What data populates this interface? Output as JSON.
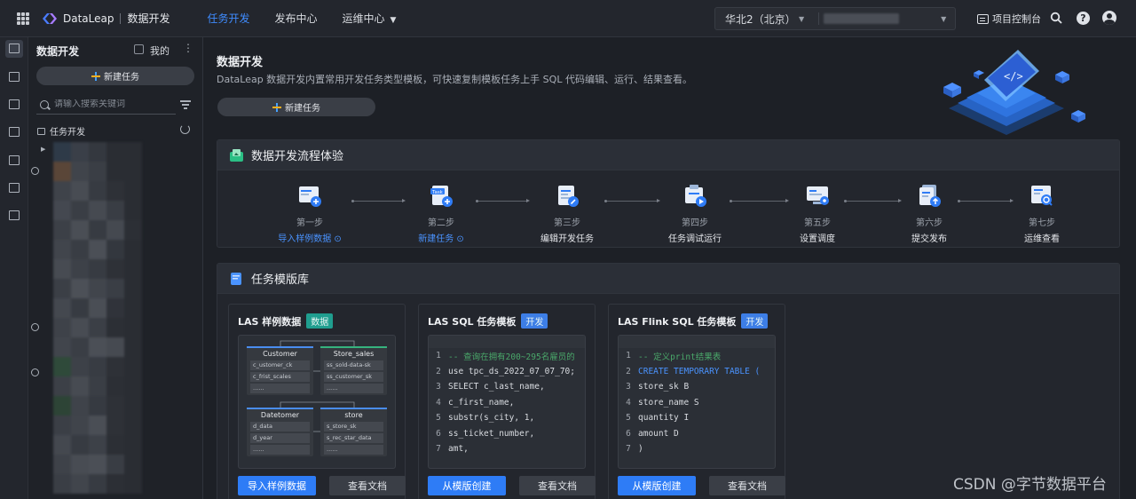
{
  "topbar": {
    "brand": "DataLeap",
    "product": "数据开发",
    "nav": [
      {
        "label": "任务开发",
        "active": true
      },
      {
        "label": "发布中心",
        "active": false
      },
      {
        "label": "运维中心",
        "active": false
      }
    ],
    "region": "华北2（北京）",
    "console_label": "项目控制台",
    "help_label": "?"
  },
  "sidebar": {
    "title": "数据开发",
    "mine_label": "我的",
    "more_label": "⋮",
    "new_task_label": "新建任务",
    "search_placeholder": "请输入搜索关键词",
    "tree_root_label": "任务开发"
  },
  "main": {
    "title": "数据开发",
    "description": "DataLeap 数据开发内置常用开发任务类型模板，可快速复制模板任务上手 SQL 代码编辑、运行、结果查看。",
    "new_task_label": "新建任务",
    "flow": {
      "title": "数据开发流程体验",
      "steps": [
        {
          "num": "第一步",
          "name": "导入样例数据 ⊙",
          "link": true
        },
        {
          "num": "第二步",
          "name": "新建任务 ⊙",
          "link": true
        },
        {
          "num": "第三步",
          "name": "编辑开发任务",
          "link": false
        },
        {
          "num": "第四步",
          "name": "任务调试运行",
          "link": false
        },
        {
          "num": "第五步",
          "name": "设置调度",
          "link": false
        },
        {
          "num": "第六步",
          "name": "提交发布",
          "link": false
        },
        {
          "num": "第七步",
          "name": "运维查看",
          "link": false
        }
      ]
    },
    "library": {
      "title": "任务模版库",
      "templates": [
        {
          "title": "LAS 样例数据",
          "tag": "数据",
          "primary": "导入样例数据",
          "secondary": "查看文档",
          "er": {
            "tables": [
              {
                "name": "Customer",
                "rows": [
                  "c_ustomer_ck",
                  "c_frist_scales",
                  "......"
                ]
              },
              {
                "name": "Store_sales",
                "rows": [
                  "ss_sold-data-sk",
                  "ss_customer_sk",
                  "......"
                ]
              },
              {
                "name": "Datetomer",
                "rows": [
                  "d_data",
                  "d_year",
                  "......"
                ]
              },
              {
                "name": "store",
                "rows": [
                  "s_store_sk",
                  "s_rec_star_data",
                  "......"
                ]
              }
            ]
          }
        },
        {
          "title": "LAS SQL 任务模板",
          "tag": "开发",
          "primary": "从模版创建",
          "secondary": "查看文档",
          "code": [
            {
              "n": "1",
              "text": "-- 查询在拥有200~295名雇员的"
            },
            {
              "n": "2",
              "text": "use tpc_ds_2022_07_07_70;"
            },
            {
              "n": "3",
              "text": "SELECT  c_last_name,"
            },
            {
              "n": "4",
              "text": "        c_first_name,"
            },
            {
              "n": "5",
              "text": "        substr(s_city, 1,"
            },
            {
              "n": "6",
              "text": "        ss_ticket_number,"
            },
            {
              "n": "7",
              "text": "        amt,"
            }
          ]
        },
        {
          "title": "LAS Flink SQL 任务模板",
          "tag": "开发",
          "primary": "从模版创建",
          "secondary": "查看文档",
          "code": [
            {
              "n": "1",
              "text": "-- 定义print结果表"
            },
            {
              "n": "2",
              "text": "CREATE  TEMPORARY TABLE ("
            },
            {
              "n": "3",
              "text": "           store_sk    B"
            },
            {
              "n": "4",
              "text": "           store_name S"
            },
            {
              "n": "5",
              "text": "           quantity    I"
            },
            {
              "n": "6",
              "text": "           amount      D"
            },
            {
              "n": "7",
              "text": "        )"
            }
          ]
        }
      ]
    }
  },
  "watermark": "CSDN @字节数据平台",
  "colors": {
    "accent": "#3f8cff",
    "primary_button": "#2e7cf6",
    "tag_data": "#1f9e8f",
    "tag_dev": "#3d7ee6"
  }
}
